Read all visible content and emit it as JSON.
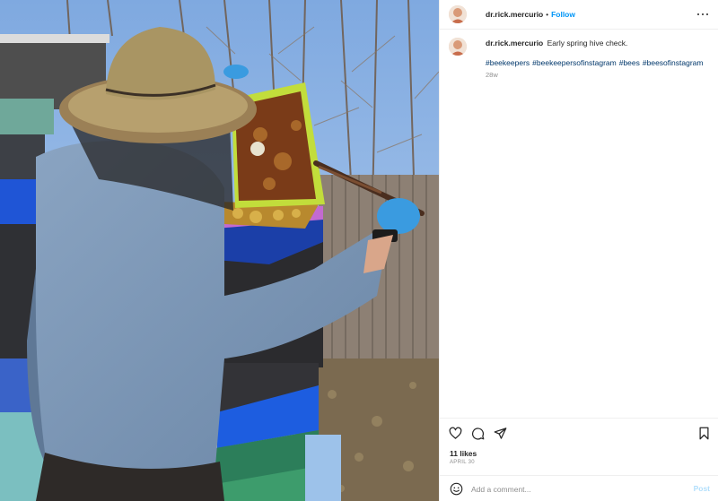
{
  "post": {
    "username": "dr.rick.mercurio",
    "separator": "•",
    "follow_label": "Follow",
    "caption": "Early spring hive check.",
    "hashtags": [
      "#beekeepers",
      "#beekeepersofinstagram",
      "#bees",
      "#beesofinstagram"
    ],
    "caption_age": "28w",
    "likes": "11 likes",
    "date": "APRIL 30"
  },
  "comment": {
    "placeholder": "Add a comment...",
    "post_label": "Post"
  },
  "icons": {
    "more": "more-options-icon",
    "like": "heart-icon",
    "comment": "comment-bubble-icon",
    "share": "paper-plane-icon",
    "save": "bookmark-icon",
    "emoji": "emoji-smiley-icon"
  },
  "colors": {
    "follow_blue": "#0095f6",
    "hashtag_blue": "#00376b",
    "post_disabled": "#b2dffc",
    "muted_text": "#8e8e8e",
    "divider": "#efefef"
  }
}
